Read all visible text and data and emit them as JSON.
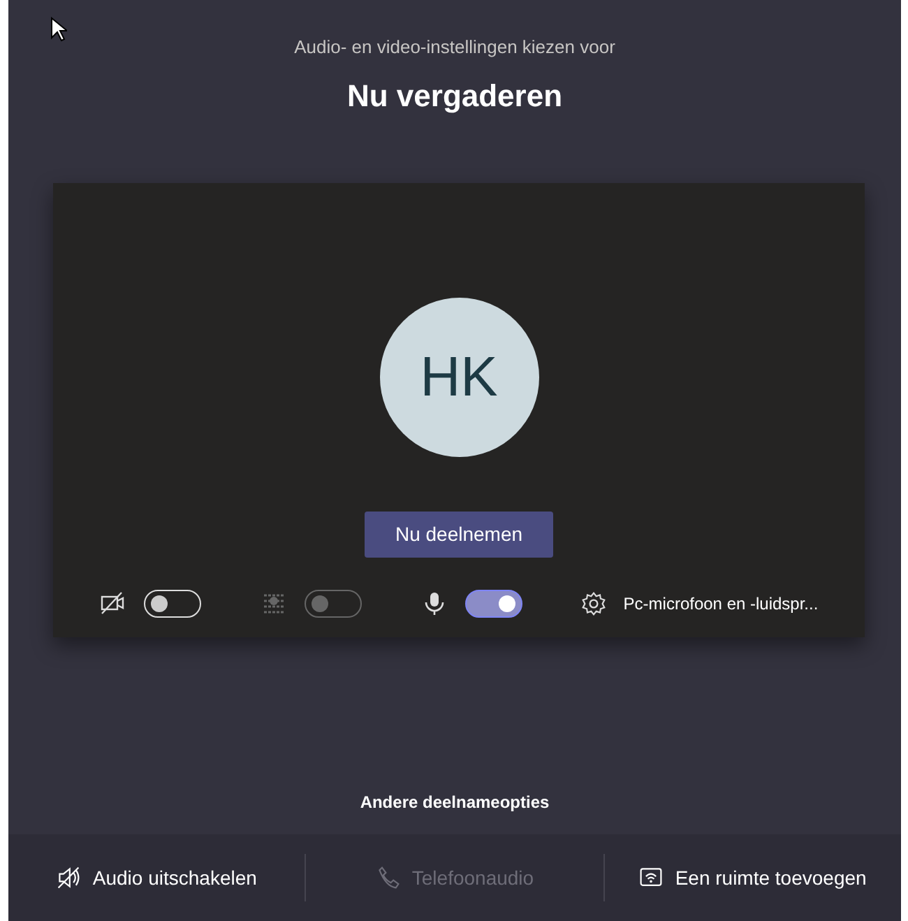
{
  "header": {
    "subtitle": "Audio- en video-instellingen kiezen voor",
    "title": "Nu vergaderen"
  },
  "preview": {
    "avatar_initials": "HK",
    "join_button": "Nu deelnemen",
    "toggles": [
      {
        "kind": "camera",
        "on": false,
        "disabled": false
      },
      {
        "kind": "blur",
        "on": false,
        "disabled": true
      },
      {
        "kind": "mic",
        "on": true,
        "disabled": false
      }
    ],
    "device_settings": "Pc-microfoon en -luidspr..."
  },
  "other_options_title": "Andere deelnameopties",
  "options": [
    {
      "kind": "audio-off",
      "label": "Audio uitschakelen",
      "disabled": false
    },
    {
      "kind": "phone",
      "label": "Telefoonaudio",
      "disabled": true
    },
    {
      "kind": "room",
      "label": "Een ruimte toevoegen",
      "disabled": false
    }
  ]
}
